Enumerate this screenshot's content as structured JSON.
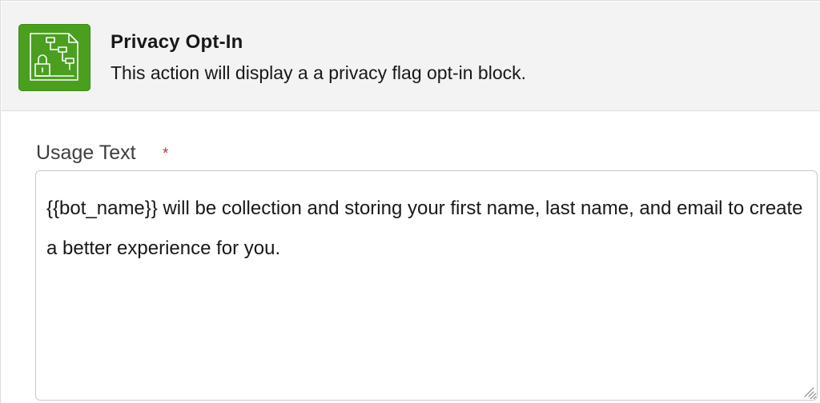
{
  "action": {
    "icon": "privacy-flow-icon",
    "title": "Privacy Opt-In",
    "description": "This action will display a a privacy flag opt-in block."
  },
  "field": {
    "label": "Usage Text",
    "required_marker": "*",
    "value": "{{bot_name}} will be collection and storing your first name, last name, and email to create a better experience for you."
  },
  "colors": {
    "icon_bg": "#4a9f1f",
    "header_bg": "#f3f3f3",
    "required": "#c23934",
    "border": "#c9c7c5"
  }
}
